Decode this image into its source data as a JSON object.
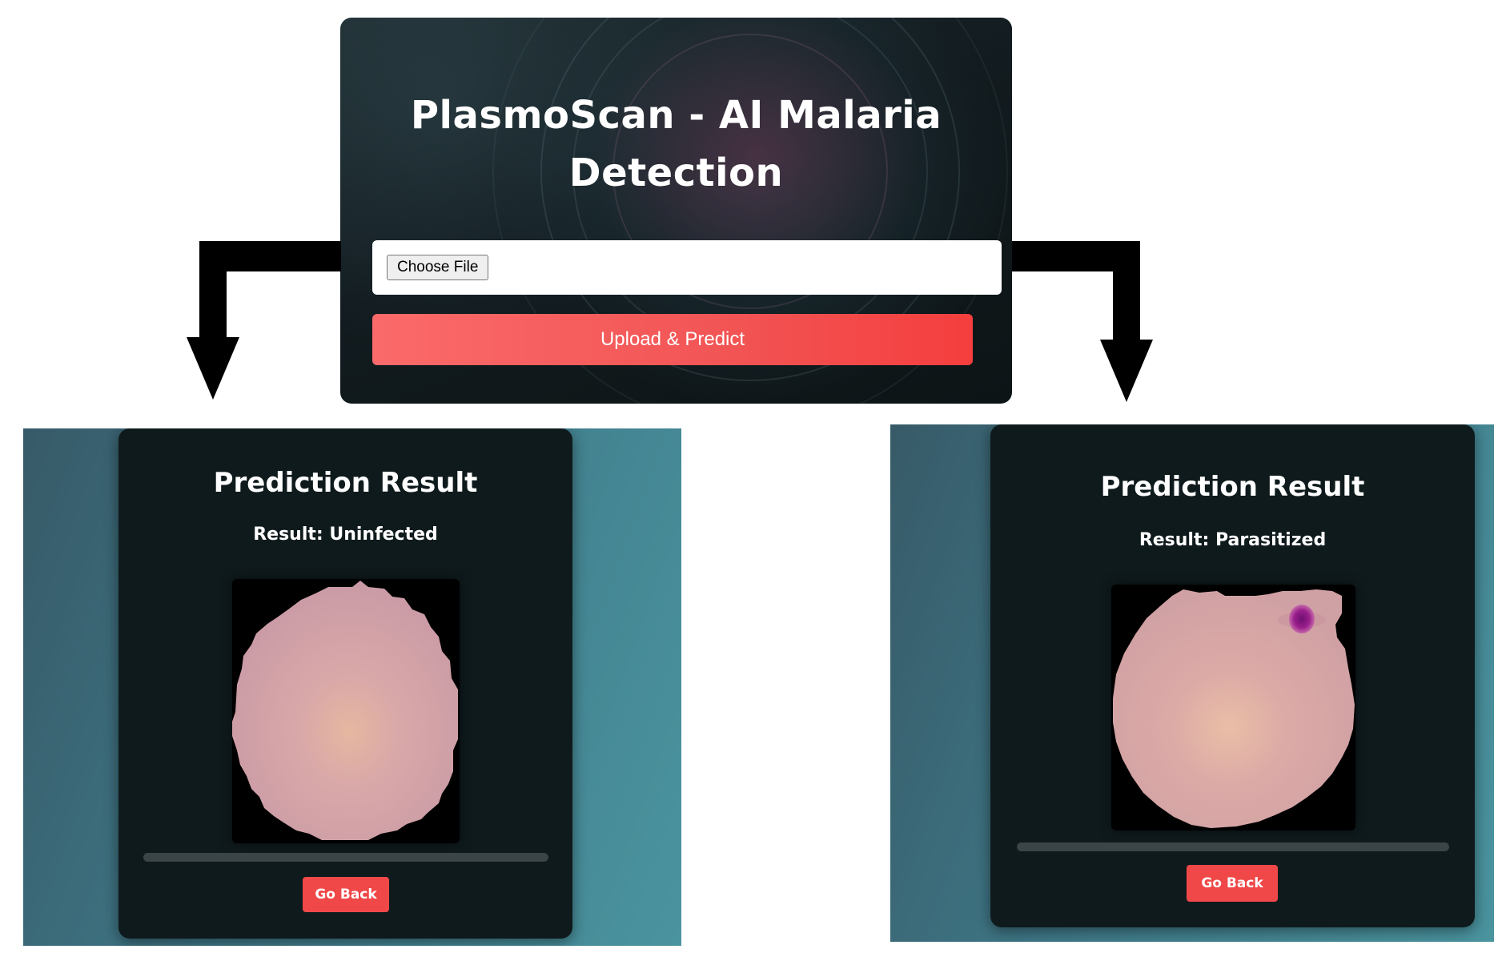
{
  "upload_page": {
    "title_line1": "PlasmoScan - AI Malaria",
    "title_line2": "Detection",
    "choose_file_label": "Choose File",
    "upload_button_label": "Upload & Predict"
  },
  "results": [
    {
      "title": "Prediction Result",
      "result_text": "Result: Uninfected",
      "go_back_label": "Go Back"
    },
    {
      "title": "Prediction Result",
      "result_text": "Result: Parasitized",
      "go_back_label": "Go Back"
    }
  ],
  "colors": {
    "accent_red": "#f04848",
    "card_dark": "#0f1a1d",
    "cell_pink": "#d9a8a8",
    "parasite_purple": "#9a1f8c"
  }
}
